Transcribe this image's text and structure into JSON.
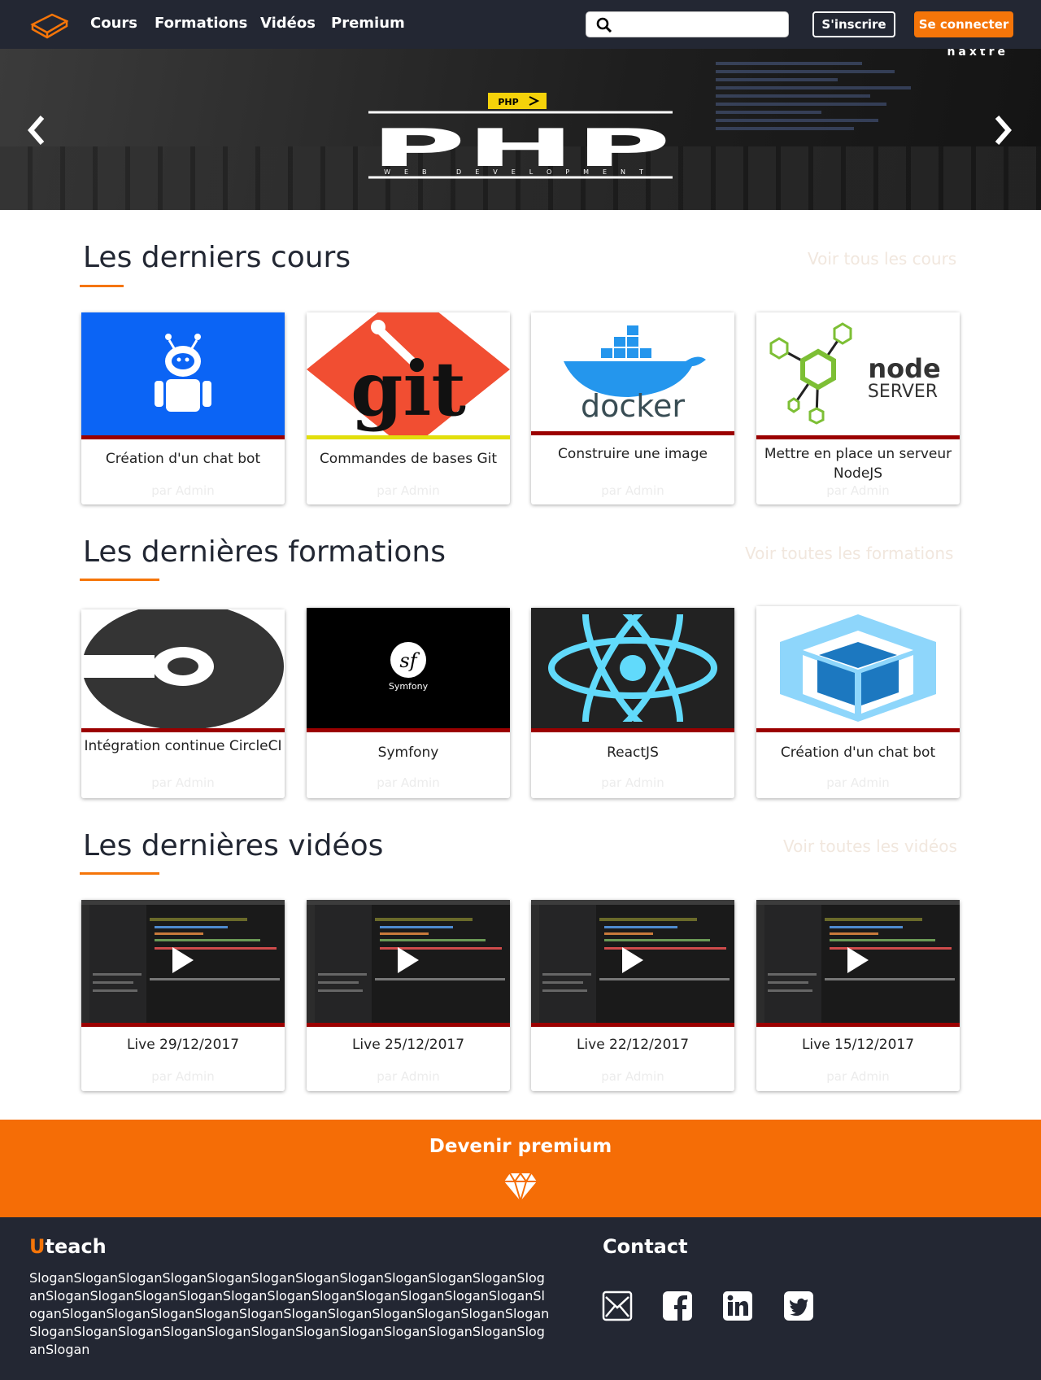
{
  "nav": {
    "links": [
      "Cours",
      "Formations",
      "Vidéos",
      "Premium"
    ],
    "search_placeholder": "",
    "register_label": "S'inscrire",
    "login_label": "Se connecter"
  },
  "hero": {
    "badge": "PHP",
    "title": "PHP",
    "subtitle": "WEB DEVELOPMENT",
    "corner_text": "naxtre"
  },
  "courses": {
    "title": "Les derniers cours",
    "link": "Voir tous les cours",
    "items": [
      {
        "title": "Création d'un chat bot",
        "author": "par Admin",
        "image": "robot-icon"
      },
      {
        "title": "Commandes de bases Git",
        "author": "par Admin",
        "image": "git-logo"
      },
      {
        "title": "Construire une image",
        "author": "par Admin",
        "image": "docker-logo"
      },
      {
        "title": "Mettre en place un serveur NodeJS",
        "author": "par Admin",
        "image": "node-server-logo"
      }
    ]
  },
  "formations": {
    "title": "Les dernières formations",
    "link": "Voir toutes les formations",
    "items": [
      {
        "title": "Intégration continue CircleCI",
        "author": "par Admin",
        "image": "circleci-logo"
      },
      {
        "title": "Symfony",
        "author": "par Admin",
        "image": "symfony-logo"
      },
      {
        "title": "ReactJS",
        "author": "par Admin",
        "image": "react-logo"
      },
      {
        "title": "Création d'un chat bot",
        "author": "par Admin",
        "image": "webpack-logo"
      }
    ]
  },
  "videos": {
    "title": "Les dernières vidéos",
    "link": "Voir toutes les vidéos",
    "items": [
      {
        "title": "Live 29/12/2017",
        "author": "par Admin",
        "image": "play-icon"
      },
      {
        "title": "Live 25/12/2017",
        "author": "par Admin",
        "image": "play-icon"
      },
      {
        "title": "Live 22/12/2017",
        "author": "par Admin",
        "image": "play-icon"
      },
      {
        "title": "Live 15/12/2017",
        "author": "par Admin",
        "image": "play-icon"
      }
    ]
  },
  "premium": {
    "title": "Devenir premium",
    "icon": "diamond-icon"
  },
  "footer": {
    "brand_first": "U",
    "brand_rest": "teach",
    "slogan": "SloganSloganSloganSloganSloganSloganSloganSloganSloganSloganSloganSloganSloganSloganSloganSloganSloganSloganSloganSloganSloganSloganSloganSloganSloganSloganSloganSloganSloganSloganSloganSloganSloganSloganSloganSloganSloganSloganSloganSloganSloganSloganSloganSloganSloganSloganSloganSlogan",
    "contact_title": "Contact",
    "socials": [
      "email-icon",
      "facebook-icon",
      "linkedin-icon",
      "twitter-icon"
    ]
  },
  "colors": {
    "accent": "#f57509",
    "navbar": "#232733",
    "card_bar": "#9b0000"
  }
}
